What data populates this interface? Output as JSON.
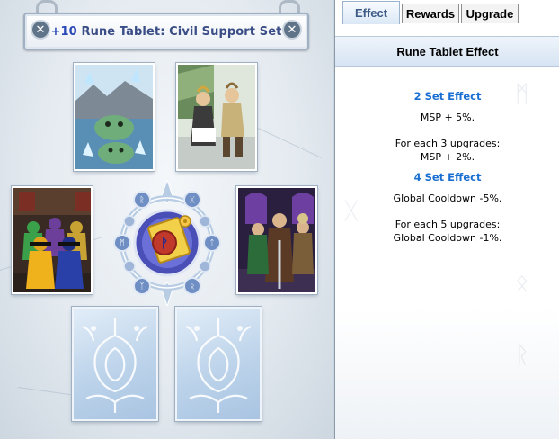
{
  "window": {
    "title_plus": "+10",
    "title_name": "Rune Tablet: Civil Support Set"
  },
  "tabs": [
    {
      "label": "Effect",
      "active": true
    },
    {
      "label": "Rewards",
      "active": false
    },
    {
      "label": "Upgrade",
      "active": false
    }
  ],
  "panel": {
    "heading": "Rune Tablet Effect"
  },
  "effects": {
    "set2_heading": "2 Set Effect",
    "set2_bonus": "MSP + 5%.",
    "set2_upgrade_line1": "For each 3 upgrades:",
    "set2_upgrade_line2": "MSP + 2%.",
    "set4_heading": "4 Set Effect",
    "set4_bonus": "Global Cooldown -5%.",
    "set4_upgrade_line1": "For each 5 upgrades:",
    "set4_upgrade_line2": "Global Cooldown -1%."
  },
  "cards": [
    {
      "slot": "top-left",
      "filled": true,
      "art": "slime-ice-cave-card"
    },
    {
      "slot": "top-right",
      "filled": true,
      "art": "villagers-dancing-card"
    },
    {
      "slot": "middle-left",
      "filled": true,
      "art": "ninja-squad-card"
    },
    {
      "slot": "middle-right",
      "filled": true,
      "art": "tavern-adventurers-card"
    },
    {
      "slot": "bottom-left",
      "filled": false,
      "art": "empty-card-slot"
    },
    {
      "slot": "bottom-right",
      "filled": false,
      "art": "empty-card-slot"
    }
  ],
  "colors": {
    "title_text": "#3a4d86",
    "set_heading": "#1a6fd2",
    "active_tab_bg": "#dbe8f6"
  }
}
